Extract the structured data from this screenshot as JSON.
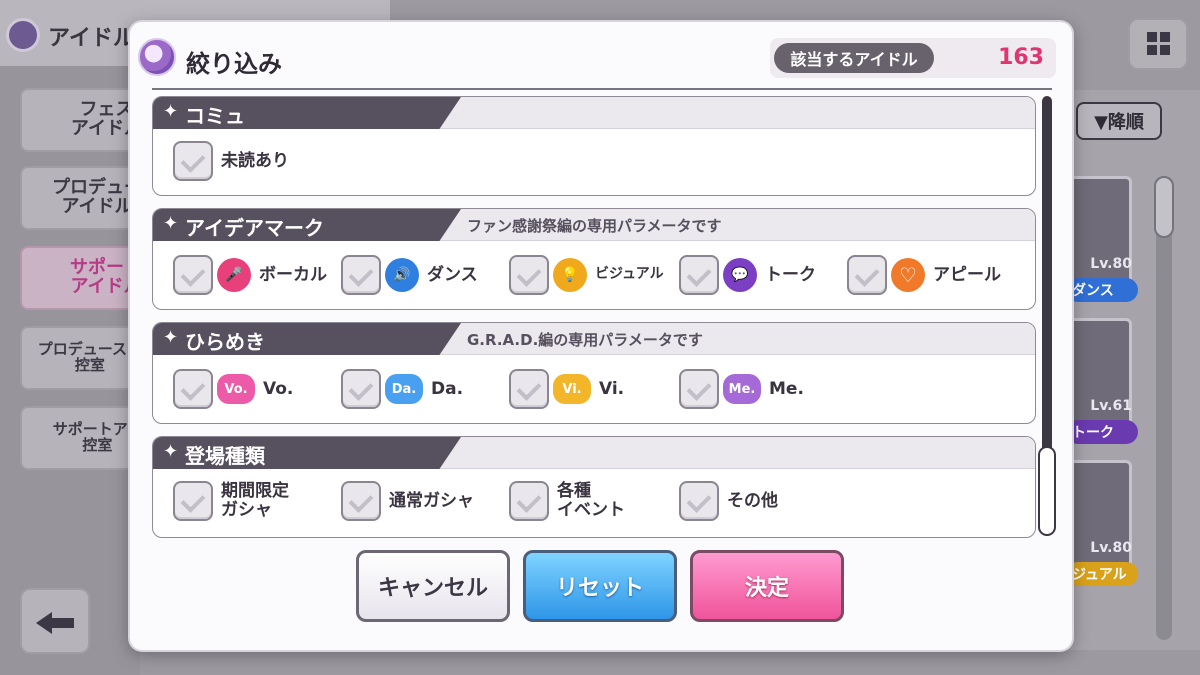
{
  "background": {
    "app_title": "アイドル",
    "side_tabs": [
      {
        "label": "フェス\nアイドル"
      },
      {
        "label": "プロデュー\nアイドル"
      },
      {
        "label": "サポート\nアイドル"
      },
      {
        "label": "プロデュースア\n控室"
      },
      {
        "label": "サポートアイ\n控室"
      }
    ],
    "sort_label": "▼降順",
    "cards": [
      {
        "level": "Lv.80",
        "type": "ダンス",
        "type_color": "#2f6fd6"
      },
      {
        "level": "Lv.61",
        "type": "トーク",
        "type_color": "#6a3ab0"
      },
      {
        "level": "Lv.80",
        "type": "ジュアル",
        "type_color": "#d9a21a"
      }
    ]
  },
  "modal": {
    "title": "絞り込み",
    "count_label": "該当するアイドル",
    "count_value": "163",
    "sections": [
      {
        "title": "コミュ",
        "note": "",
        "options": [
          {
            "label": "未読あり"
          }
        ]
      },
      {
        "title": "アイデアマーク",
        "note": "ファン感謝祭編の専用パラメータです",
        "options": [
          {
            "label": "ボーカル",
            "badge": "🎤",
            "color": "#e8407a"
          },
          {
            "label": "ダンス",
            "badge": "🔊",
            "color": "#2f7fe0"
          },
          {
            "label": "ビジュアル",
            "badge": "💡",
            "color": "#f0a81c"
          },
          {
            "label": "トーク",
            "badge": "💬",
            "color": "#7b3fc4"
          },
          {
            "label": "アピール",
            "badge": "♡",
            "color": "#f07a2a"
          }
        ]
      },
      {
        "title": "ひらめき",
        "note": "G.R.A.D.編の専用パラメータです",
        "options": [
          {
            "label": "Vo.",
            "badge": "Vo.",
            "color": "#ec5aa8"
          },
          {
            "label": "Da.",
            "badge": "Da.",
            "color": "#4aa0f0"
          },
          {
            "label": "Vi.",
            "badge": "Vi.",
            "color": "#f3b52a"
          },
          {
            "label": "Me.",
            "badge": "Me.",
            "color": "#a56ad8"
          }
        ]
      },
      {
        "title": "登場種類",
        "note": "",
        "options": [
          {
            "label": "期間限定\nガシャ"
          },
          {
            "label": "通常ガシャ"
          },
          {
            "label": "各種\nイベント"
          },
          {
            "label": "その他"
          }
        ]
      }
    ],
    "buttons": {
      "cancel": "キャンセル",
      "reset": "リセット",
      "confirm": "決定"
    }
  }
}
